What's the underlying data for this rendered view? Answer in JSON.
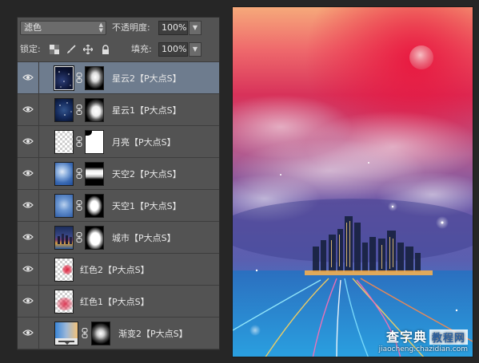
{
  "options": {
    "blend_mode": "滤色",
    "opacity_label": "不透明度:",
    "opacity_value": "100%",
    "lock_label": "锁定:",
    "fill_label": "填充:",
    "fill_value": "100%",
    "lock_icons": [
      "lock-transparent-icon",
      "lock-paint-icon",
      "lock-position-icon",
      "lock-all-icon"
    ]
  },
  "layers": [
    {
      "name": "星云2【P大点S】",
      "thumb": "nebula-dark",
      "mask": "cloud-mask-a",
      "selected": true
    },
    {
      "name": "星云1【P大点S】",
      "thumb": "nebula-blue",
      "mask": "cloud-mask-b",
      "selected": false
    },
    {
      "name": "月亮【P大点S】",
      "thumb": "transparent",
      "mask": "white-mask",
      "selected": false
    },
    {
      "name": "天空2【P大点S】",
      "thumb": "sky-clouds",
      "mask": "band-mask",
      "selected": false
    },
    {
      "name": "天空1【P大点S】",
      "thumb": "sky-blue",
      "mask": "blob-mask",
      "selected": false
    },
    {
      "name": "城市【P大点S】",
      "thumb": "city",
      "mask": "city-mask",
      "selected": false
    },
    {
      "name": "红色2【P大点S】",
      "thumb": "red-spot",
      "mask": "",
      "selected": false
    },
    {
      "name": "红色1【P大点S】",
      "thumb": "red-glow",
      "mask": "",
      "selected": false
    },
    {
      "name": "渐变2【P大点S】",
      "thumb": "gradient",
      "mask": "radial-mask",
      "selected": false
    }
  ],
  "watermark": {
    "brand": "查字典",
    "tag": "教程网",
    "url": "jiaocheng.chazidian.com"
  }
}
